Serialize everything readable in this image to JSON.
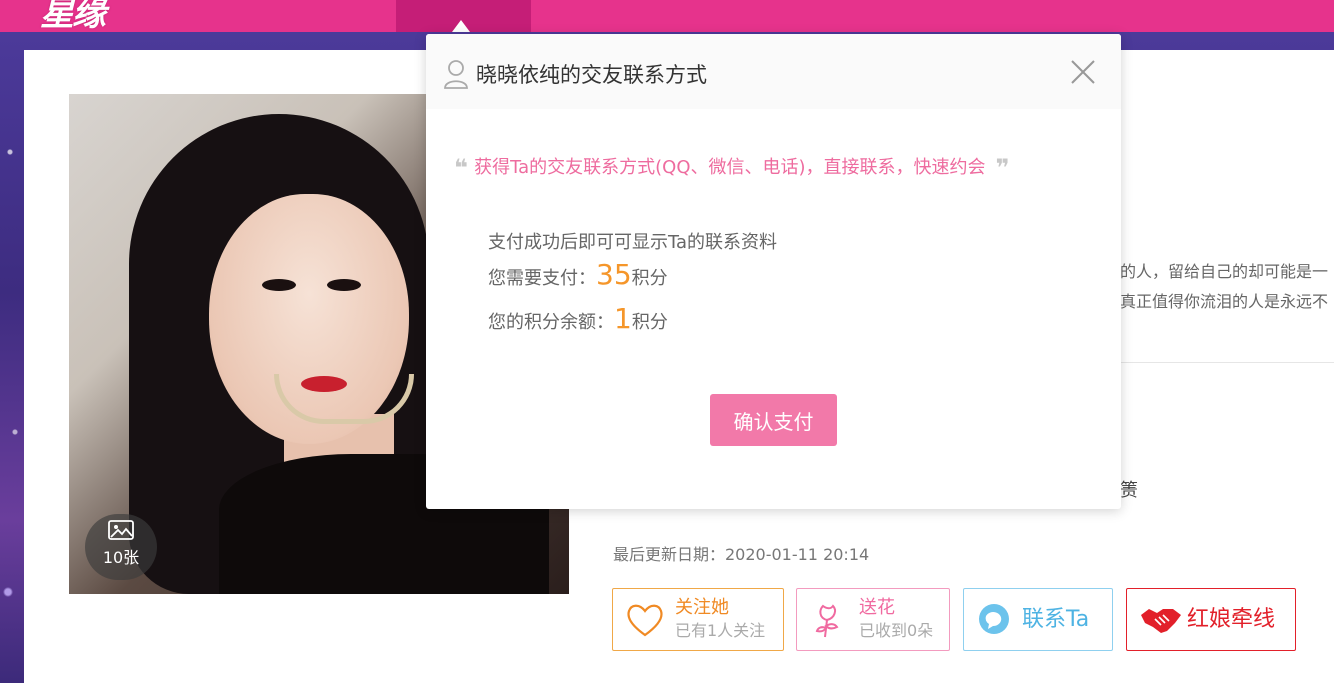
{
  "site": {
    "logo_text": "星缘"
  },
  "profile": {
    "photo_count_label": "10张",
    "bio_line1": "的人，留给自己的却可能是一",
    "bio_line2": "真正值得你流泪的人是永远不",
    "info_fragment": "箦",
    "update_label": "最后更新日期：2020-01-11 20:14"
  },
  "actions": {
    "follow_label": "关注她",
    "follow_sub": "已有1人关注",
    "flower_label": "送花",
    "flower_sub": "已收到0朵",
    "contact_label": "联系Ta",
    "matchmaker_label": "红娘牵线"
  },
  "modal": {
    "title": "晓晓依纯的交友联系方式",
    "quote": "获得Ta的交友联系方式(QQ、微信、电话)，直接联系，快速约会",
    "pay_info": "支付成功后即可可显示Ta的联系资料",
    "need_pay_label": "您需要支付：",
    "need_pay_value": "35",
    "points_unit": "积分",
    "balance_label": "您的积分余额：",
    "balance_value": "1",
    "confirm_label": "确认支付"
  },
  "colors": {
    "brand_pink": "#e6338c",
    "accent_orange": "#f5962a",
    "confirm_pink": "#f279a9"
  }
}
